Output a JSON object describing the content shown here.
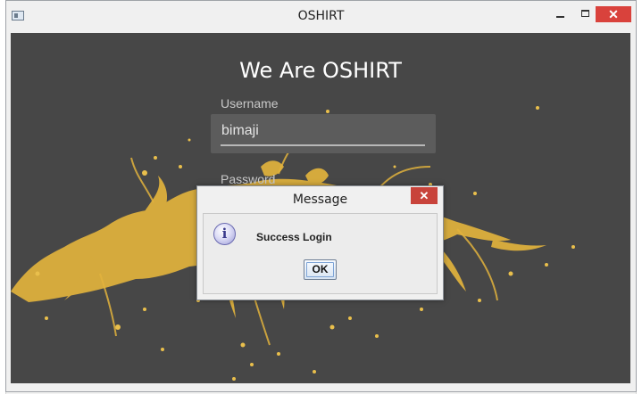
{
  "window": {
    "title": "OSHIRT",
    "icons": {
      "app": "window-icon",
      "minimize": "minimize-icon",
      "maximize": "maximize-icon",
      "close": "close-icon"
    },
    "close_glyph": "✕"
  },
  "login": {
    "heading": "We Are OSHIRT",
    "username_label": "Username",
    "username_value": "bimaji",
    "password_label": "Password"
  },
  "dialog": {
    "title": "Message",
    "close_glyph": "✕",
    "icon": "info-icon",
    "icon_glyph": "i",
    "message": "Success Login",
    "ok_label": "OK"
  },
  "colors": {
    "background": "#474747",
    "splash": "#e2b33d",
    "close": "#d9423c"
  }
}
